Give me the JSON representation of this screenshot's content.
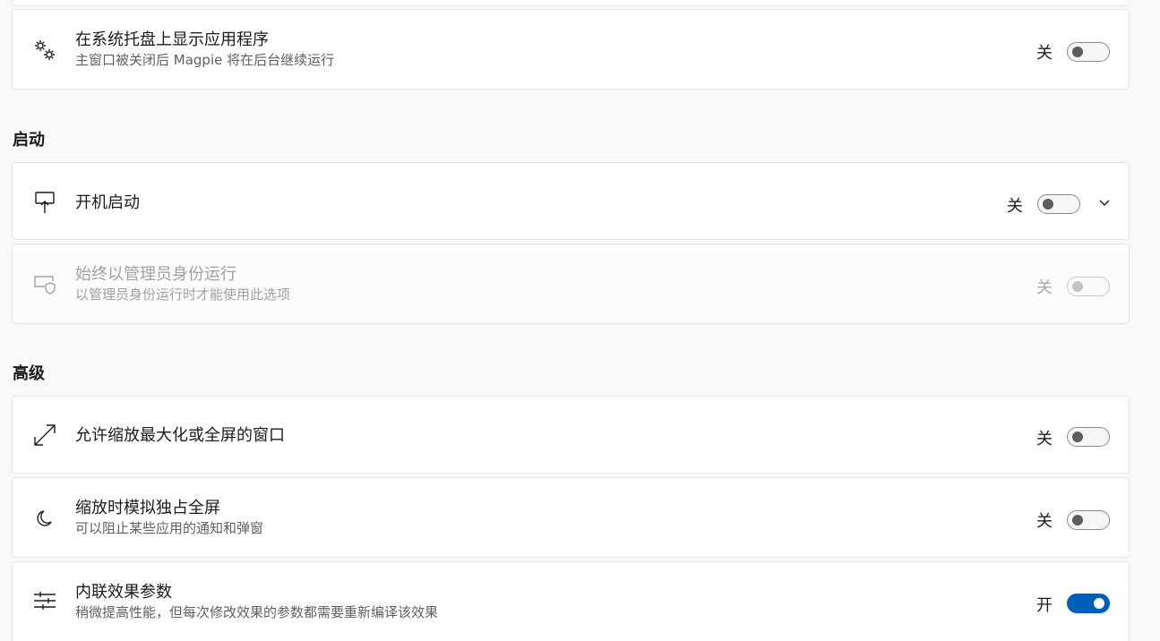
{
  "sections": {
    "startup": "启动",
    "advanced": "高级"
  },
  "settings": {
    "tray": {
      "title": "在系统托盘上显示应用程序",
      "desc": "主窗口被关闭后 Magpie 将在后台继续运行",
      "state": "关",
      "on": false,
      "icon": "gears-icon"
    },
    "autostart": {
      "title": "开机启动",
      "state": "关",
      "on": false,
      "icon": "startup-icon"
    },
    "admin": {
      "title": "始终以管理员身份运行",
      "desc": "以管理员身份运行时才能使用此选项",
      "state": "关",
      "on": false,
      "disabled": true,
      "icon": "shield-window-icon"
    },
    "maximized": {
      "title": "允许缩放最大化或全屏的窗口",
      "state": "关",
      "on": false,
      "icon": "resize-arrows-icon"
    },
    "exclusive": {
      "title": "缩放时模拟独占全屏",
      "desc": "可以阻止某些应用的通知和弹窗",
      "state": "关",
      "on": false,
      "icon": "moon-icon"
    },
    "inline": {
      "title": "内联效果参数",
      "desc": "稍微提高性能，但每次修改效果的参数都需要重新编译该效果",
      "state": "开",
      "on": true,
      "icon": "sliders-icon"
    }
  },
  "colors": {
    "accent": "#005fb8",
    "background": "#f9f9f9",
    "card": "#ffffff"
  }
}
